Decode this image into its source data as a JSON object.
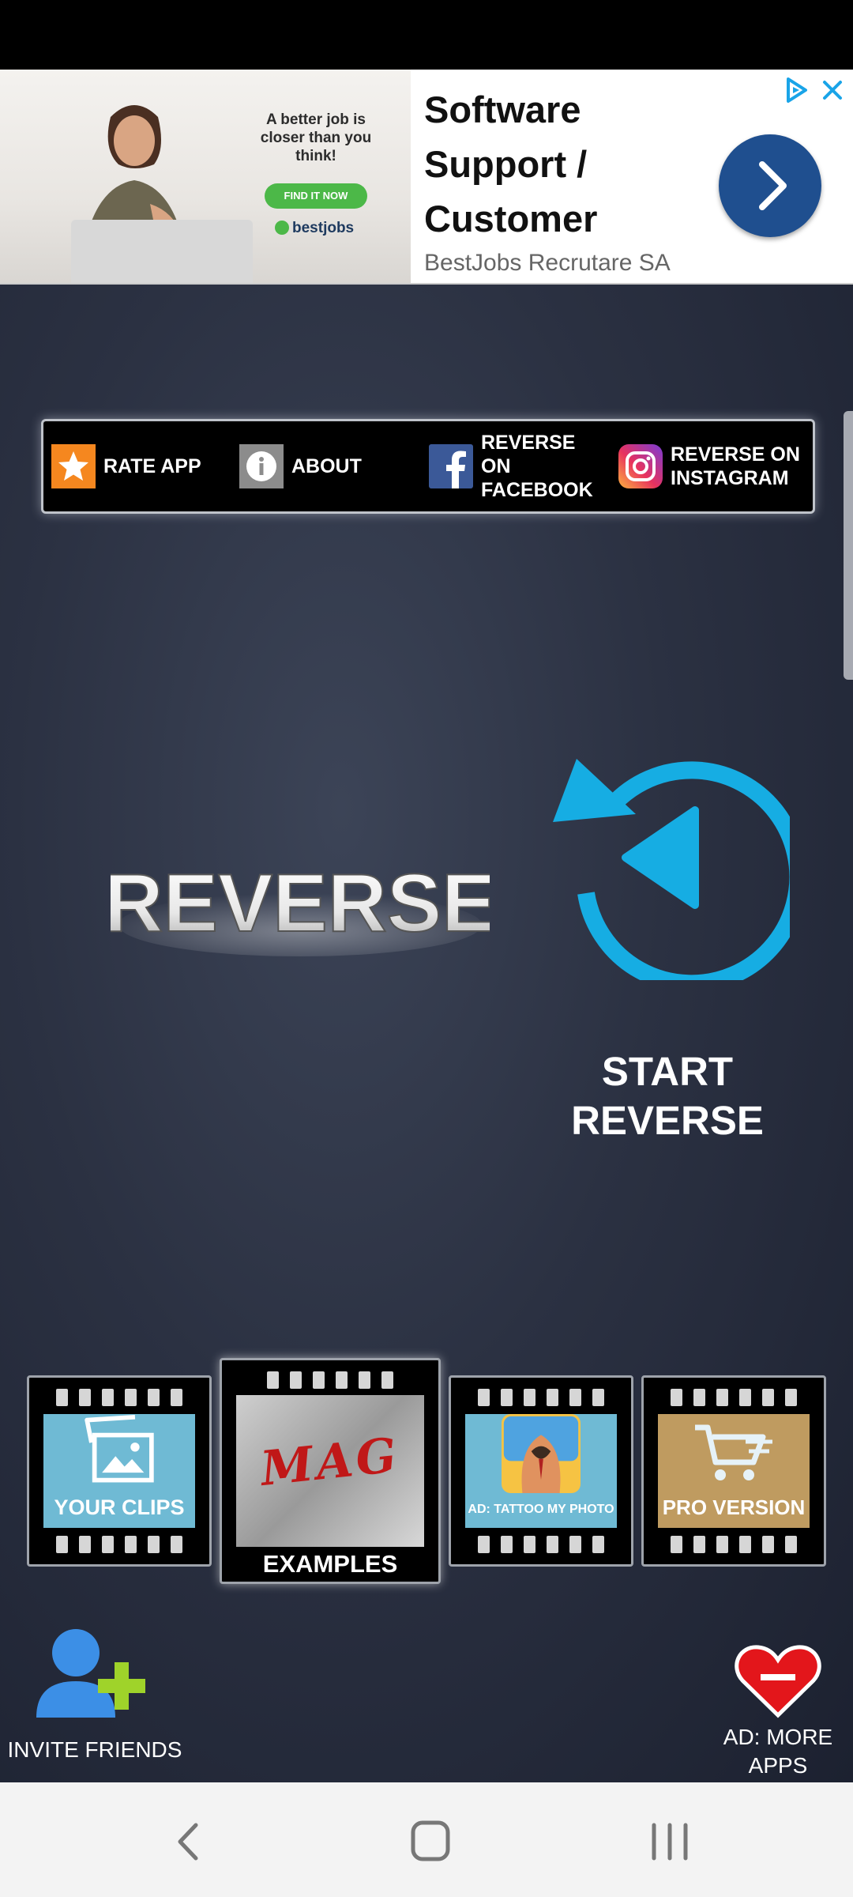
{
  "ad": {
    "image_tagline": "A better job is closer than you think!",
    "image_button": "FIND IT NOW",
    "image_brand": "bestjobs",
    "headline": "Software Support / Customer",
    "advertiser": "BestJobs Recrutare SA",
    "icons": {
      "choices": "ad-choices-icon",
      "close": "close-icon",
      "arrow": "chevron-right-icon"
    },
    "colors": {
      "button": "#1f4f8f",
      "accent": "#4cb848"
    }
  },
  "menu": {
    "rate": "RATE APP",
    "about": "ABOUT",
    "facebook": "REVERSE ON FACEBOOK",
    "instagram": "REVERSE ON INSTAGRAM",
    "icons": [
      "star-icon",
      "info-icon",
      "facebook-icon",
      "instagram-icon"
    ]
  },
  "logo": {
    "text": "REVERSE"
  },
  "start": {
    "label": "START REVERSE",
    "icon": "reverse-play-icon",
    "color": "#16ade3"
  },
  "tiles": {
    "your_clips": "YOUR CLIPS",
    "examples": "EXAMPLES",
    "examples_art_text": "MAG",
    "tattoo": "AD: TATTOO MY PHOTO",
    "pro": "PRO VERSION"
  },
  "bottom": {
    "invite": "INVITE FRIENDS",
    "more_apps": "AD: MORE APPS",
    "icons": [
      "add-user-icon",
      "heart-icon"
    ]
  },
  "nav": {
    "icons": [
      "back-icon",
      "home-icon",
      "recents-icon"
    ]
  }
}
